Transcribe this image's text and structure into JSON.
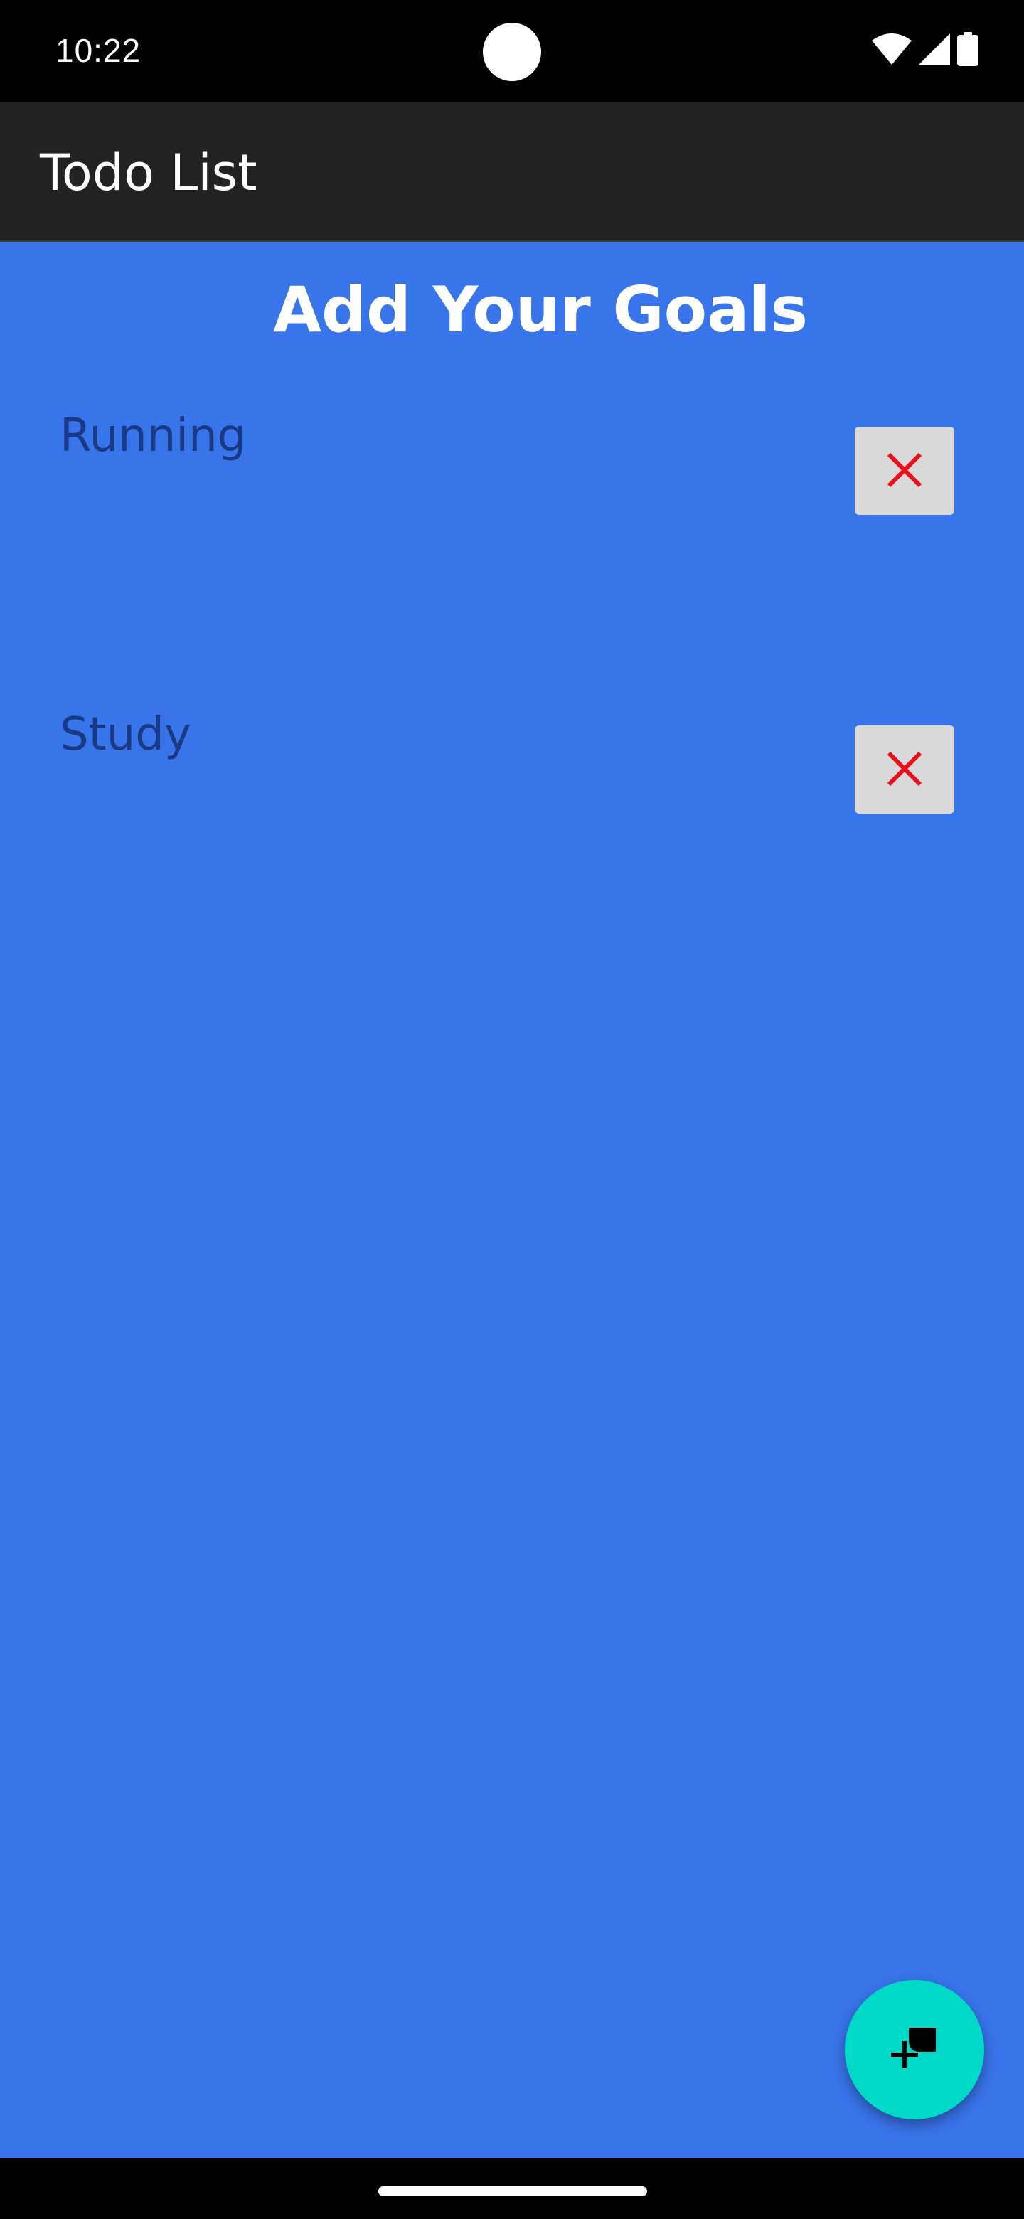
{
  "status_bar": {
    "time": "10:22",
    "icons": [
      "wifi-icon",
      "cellular-signal-icon",
      "battery-icon"
    ]
  },
  "app_bar": {
    "title": "Todo List"
  },
  "main": {
    "heading": "Add Your Goals",
    "goals": [
      {
        "label": "Running",
        "delete_icon": "close-icon"
      },
      {
        "label": "Study",
        "delete_icon": "close-icon"
      }
    ]
  },
  "fab": {
    "icon": "add-note-icon"
  },
  "colors": {
    "content_background": "#3874ea",
    "app_bar_background": "#222222",
    "goal_text": "#1b3a85",
    "delete_button_background": "#d9d9d9",
    "delete_icon": "#e8111b",
    "fab_background": "#00d9c8"
  }
}
